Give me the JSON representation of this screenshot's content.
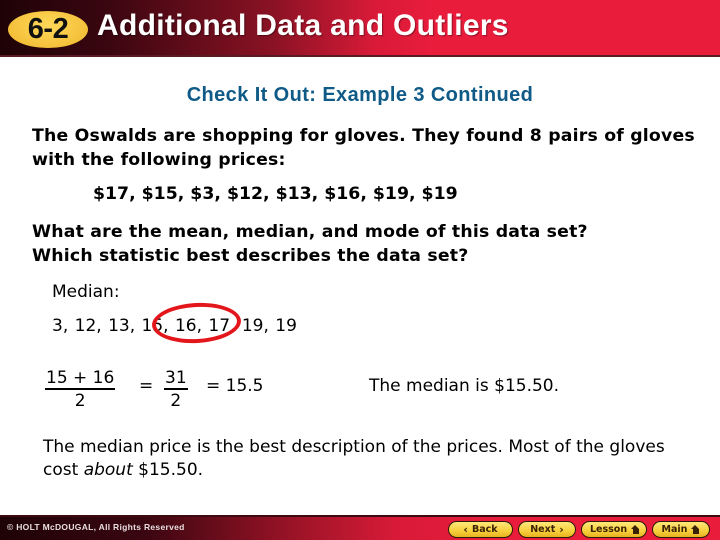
{
  "header": {
    "badge": "6-2",
    "title": "Additional Data and Outliers",
    "colors": {
      "gradient_dark": "#1e0306",
      "gradient_red": "#ea1c3c",
      "badge": "#f4c03a"
    }
  },
  "slide": {
    "subtitle": "Check It Out: Example 3 Continued",
    "problem": "The Oswalds are shopping for gloves. They found 8 pairs of gloves with the following prices:",
    "prices": "$17, $15, $3, $12, $13, $16, $19, $19",
    "question_line1": "What are the mean, median, and mode of this data set?",
    "question_line2": "Which statistic best describes the data set?",
    "median_label": "Median:",
    "ordered_data": "3, 12, 13, 15, 16, 17, 19, 19",
    "highlighted_values": [
      "15",
      "16"
    ],
    "formula": {
      "frac1_num": "15 + 16",
      "frac1_den": "2",
      "eq": "=",
      "frac2_num": "31",
      "frac2_den": "2",
      "result": "= 15.5"
    },
    "median_result": "The median is $15.50.",
    "conclusion_part1": "The median price is the best description of the prices. Most of the gloves cost ",
    "conclusion_emphasis": "about",
    "conclusion_part2": " $15.50.",
    "colors": {
      "subtitle": "#0f5a86",
      "highlight_circle": "#e3161c"
    }
  },
  "footer": {
    "copyright": "© HOLT McDOUGAL, All Rights Reserved",
    "nav": {
      "back": "Back",
      "next": "Next",
      "lesson": "Lesson",
      "main": "Main"
    },
    "icons": {
      "back": "chevron-left-icon",
      "next": "chevron-right-icon",
      "lesson": "home-icon",
      "main": "home-icon"
    }
  }
}
